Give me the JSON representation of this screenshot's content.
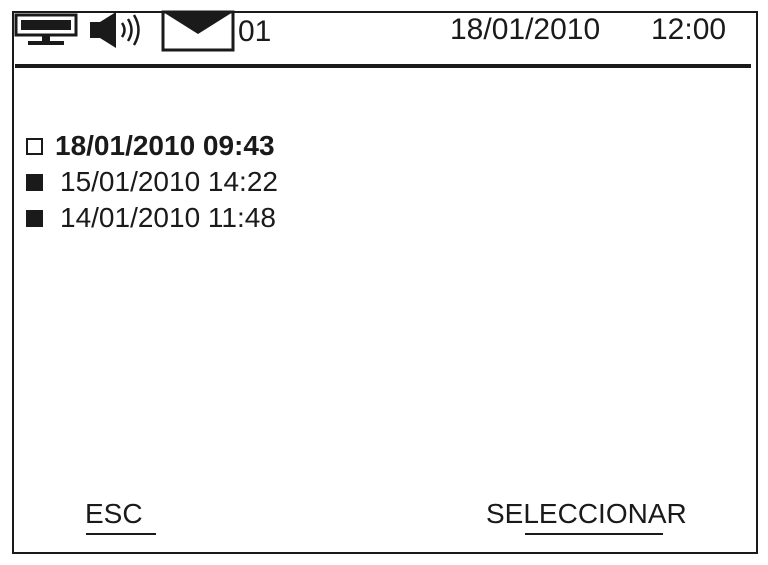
{
  "status_bar": {
    "icons": [
      "network-icon",
      "speaker-icon",
      "envelope-icon"
    ],
    "message_count": "01",
    "date": "18/01/2010",
    "time": "12:00"
  },
  "entries": [
    {
      "text": "18/01/2010 09:43",
      "read": false,
      "selected": true
    },
    {
      "text": "15/01/2010 14:22",
      "read": true,
      "selected": false
    },
    {
      "text": "14/01/2010 11:48",
      "read": true,
      "selected": false
    }
  ],
  "softkeys": {
    "left_label": "ESC",
    "right_label": "SELECCIONAR"
  }
}
